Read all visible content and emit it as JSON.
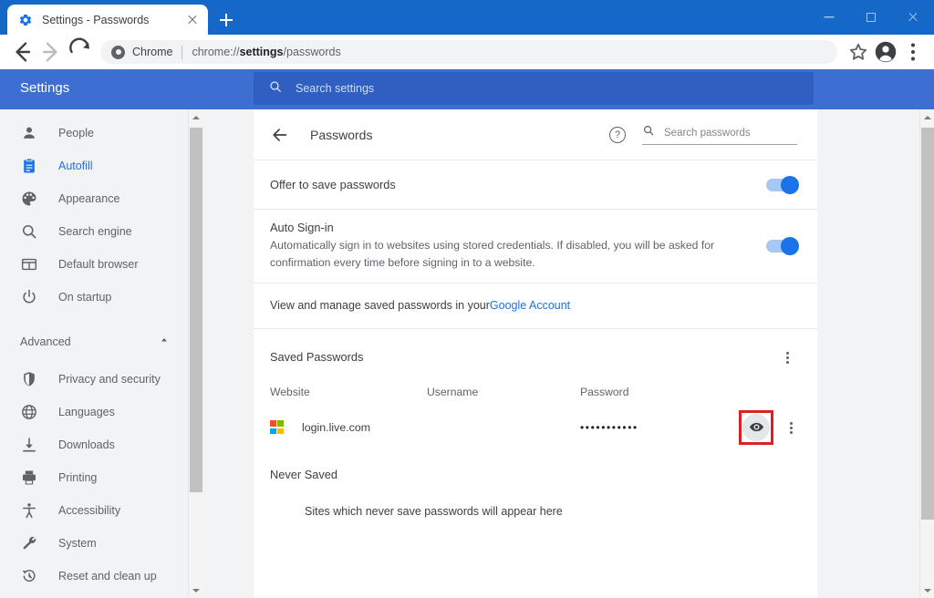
{
  "window": {
    "controls": {
      "minimize": "minimize-button",
      "maximize": "maximize-button",
      "close": "close-button"
    }
  },
  "tab": {
    "title": "Settings - Passwords",
    "favicon": "gear-icon",
    "close_label": "close-tab",
    "new_tab_label": "new-tab"
  },
  "toolbar": {
    "back": "back-arrow-icon",
    "forward": "forward-arrow-icon",
    "reload": "reload-icon",
    "omnibox": {
      "chip": "Chrome",
      "url_prefix": "chrome://",
      "url_bold": "settings",
      "url_suffix": "/passwords",
      "full_url": "chrome://settings/passwords"
    },
    "bookmark": "star-icon",
    "profile": "profile-avatar-icon",
    "menu": "three-dot-menu-icon"
  },
  "settings_header": {
    "title": "Settings",
    "search_placeholder": "Search settings",
    "search_value": ""
  },
  "sidebar": {
    "items": [
      {
        "label": "People",
        "icon": "person-icon",
        "active": false
      },
      {
        "label": "Autofill",
        "icon": "clipboard-icon",
        "active": true
      },
      {
        "label": "Appearance",
        "icon": "palette-icon",
        "active": false
      },
      {
        "label": "Search engine",
        "icon": "search-icon",
        "active": false
      },
      {
        "label": "Default browser",
        "icon": "window-icon",
        "active": false
      },
      {
        "label": "On startup",
        "icon": "power-icon",
        "active": false
      }
    ],
    "advanced": {
      "label": "Advanced",
      "expanded": true,
      "chevron": "chevron-up-icon"
    },
    "advanced_items": [
      {
        "label": "Privacy and security",
        "icon": "shield-icon"
      },
      {
        "label": "Languages",
        "icon": "globe-icon"
      },
      {
        "label": "Downloads",
        "icon": "download-icon"
      },
      {
        "label": "Printing",
        "icon": "printer-icon"
      },
      {
        "label": "Accessibility",
        "icon": "accessibility-icon"
      },
      {
        "label": "System",
        "icon": "wrench-icon"
      },
      {
        "label": "Reset and clean up",
        "icon": "history-restore-icon"
      }
    ]
  },
  "main": {
    "page_title": "Passwords",
    "back": "back-arrow-icon",
    "help": "help-icon",
    "search_passwords_placeholder": "Search passwords",
    "search_passwords_value": "",
    "offer_to_save": {
      "label": "Offer to save passwords",
      "enabled": true
    },
    "auto_signin": {
      "title": "Auto Sign-in",
      "description": "Automatically sign in to websites using stored credentials. If disabled, you will be asked for confirmation every time before signing in to a website.",
      "enabled": true
    },
    "manage_note": {
      "prefix": "View and manage saved passwords in your ",
      "link": "Google Account"
    },
    "saved_passwords": {
      "heading": "Saved Passwords",
      "menu": "three-dot-menu-icon",
      "columns": [
        "Website",
        "Username",
        "Password"
      ],
      "rows": [
        {
          "website": "login.live.com",
          "favicon": "microsoft-logo-icon",
          "username": "",
          "password_masked": "•••••••••••",
          "show_password": "eye-icon",
          "row_menu": "three-dot-menu-icon",
          "highlighted": true
        }
      ]
    },
    "never_saved": {
      "heading": "Never Saved",
      "empty_text": "Sites which never save passwords will appear here"
    }
  },
  "colors": {
    "titlebar_blue": "#1567c8",
    "settings_blue": "#3c6fd1",
    "search_blue": "#2f5fc0",
    "accent_blue": "#1a73e8",
    "highlight_red": "#e02020",
    "text_primary": "#3c4043",
    "text_secondary": "#5f6368"
  },
  "scrollbars": {
    "sidebar": "sidebar-scrollbar",
    "main": "main-scrollbar"
  }
}
